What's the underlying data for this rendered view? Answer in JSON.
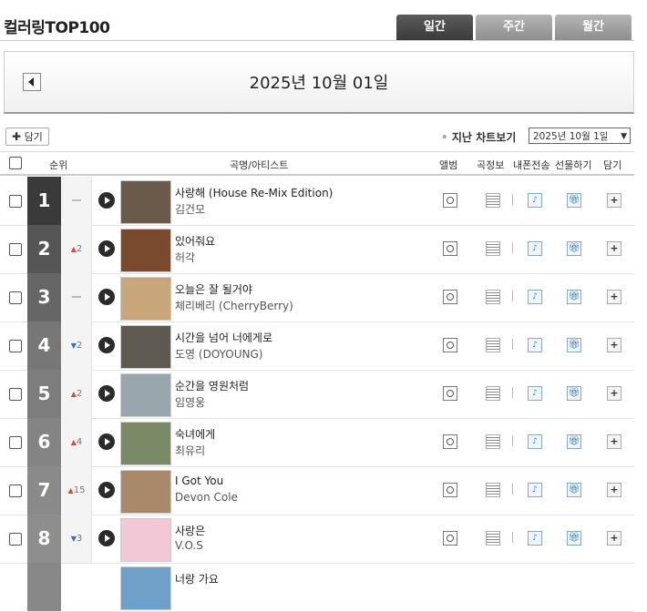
{
  "header": {
    "title": "컬러링TOP100"
  },
  "tabs": [
    "일간",
    "주간",
    "월간"
  ],
  "date_bar": {
    "title": "2025년 10월 01일"
  },
  "toolbar": {
    "add_label": "담기",
    "past_chart_label": "지난 차트보기",
    "date_select": "2025년 10월 1일"
  },
  "columns": {
    "rank": "순위",
    "song_artist": "곡명/아티스트",
    "album": "앨범",
    "lyrics": "곡정보",
    "phone": "내폰전송",
    "gift": "선물하기",
    "add": "담기"
  },
  "rows": [
    {
      "rank": "1",
      "change": "",
      "dir": "same",
      "song": "사랑해 (House Re-Mix Edition)",
      "artist": "김건모",
      "thumb": "#6a5a4a"
    },
    {
      "rank": "2",
      "change": "2",
      "dir": "up",
      "song": "있어줘요",
      "artist": "허각",
      "thumb": "#7a4a2e"
    },
    {
      "rank": "3",
      "change": "",
      "dir": "same",
      "song": "오늘은 잘 될거야",
      "artist": "체리베리 (CherryBerry)",
      "thumb": "#c9a67a"
    },
    {
      "rank": "4",
      "change": "2",
      "dir": "down",
      "song": "시간을 넘어 너에게로",
      "artist": "도영 (DOYOUNG)",
      "thumb": "#5e5a52"
    },
    {
      "rank": "5",
      "change": "2",
      "dir": "up",
      "song": "순간을 영원처럼",
      "artist": "임영웅",
      "thumb": "#9aa6ad"
    },
    {
      "rank": "6",
      "change": "4",
      "dir": "up",
      "song": "숙녀에게",
      "artist": "최유리",
      "thumb": "#7a8a66"
    },
    {
      "rank": "7",
      "change": "15",
      "dir": "up",
      "song": "I Got You",
      "artist": "Devon Cole",
      "thumb": "#a88a6a"
    },
    {
      "rank": "8",
      "change": "3",
      "dir": "down",
      "song": "사랑은",
      "artist": "V.O.S",
      "thumb": "#f2c8d6"
    }
  ],
  "partial_row": {
    "song": "너랑 가요",
    "thumb": "#6fa0c8"
  }
}
